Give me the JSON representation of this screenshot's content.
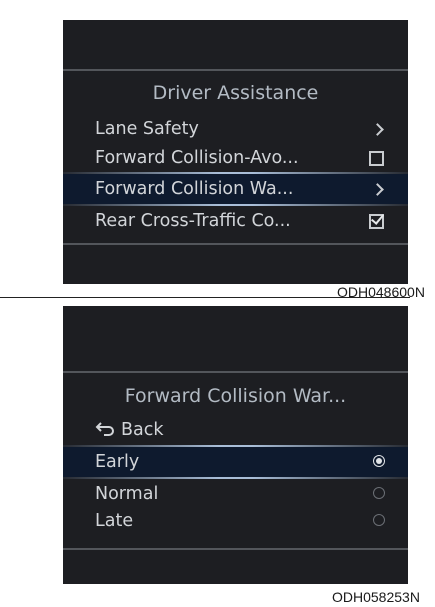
{
  "screen1": {
    "title": "Driver Assistance",
    "items": [
      {
        "label": "Lane Safety",
        "control": "chevron"
      },
      {
        "label": "Forward Collision-Avo...",
        "control": "checkbox",
        "checked": false
      },
      {
        "label": "Forward Collision Wa...",
        "control": "chevron",
        "selected": true
      },
      {
        "label": "Rear Cross-Traffic Co...",
        "control": "checkbox",
        "checked": true
      }
    ],
    "image_code": "ODH048600N"
  },
  "screen2": {
    "title": "Forward Collision War...",
    "back_label": "Back",
    "options": [
      {
        "label": "Early",
        "selected": true
      },
      {
        "label": "Normal",
        "selected": false
      },
      {
        "label": "Late",
        "selected": false
      }
    ],
    "image_code": "ODH058253N"
  },
  "icons": {
    "chevron": "chevron-right-icon",
    "checkbox": "checkbox-icon",
    "radio": "radio-icon",
    "back": "back-arrow-icon"
  }
}
